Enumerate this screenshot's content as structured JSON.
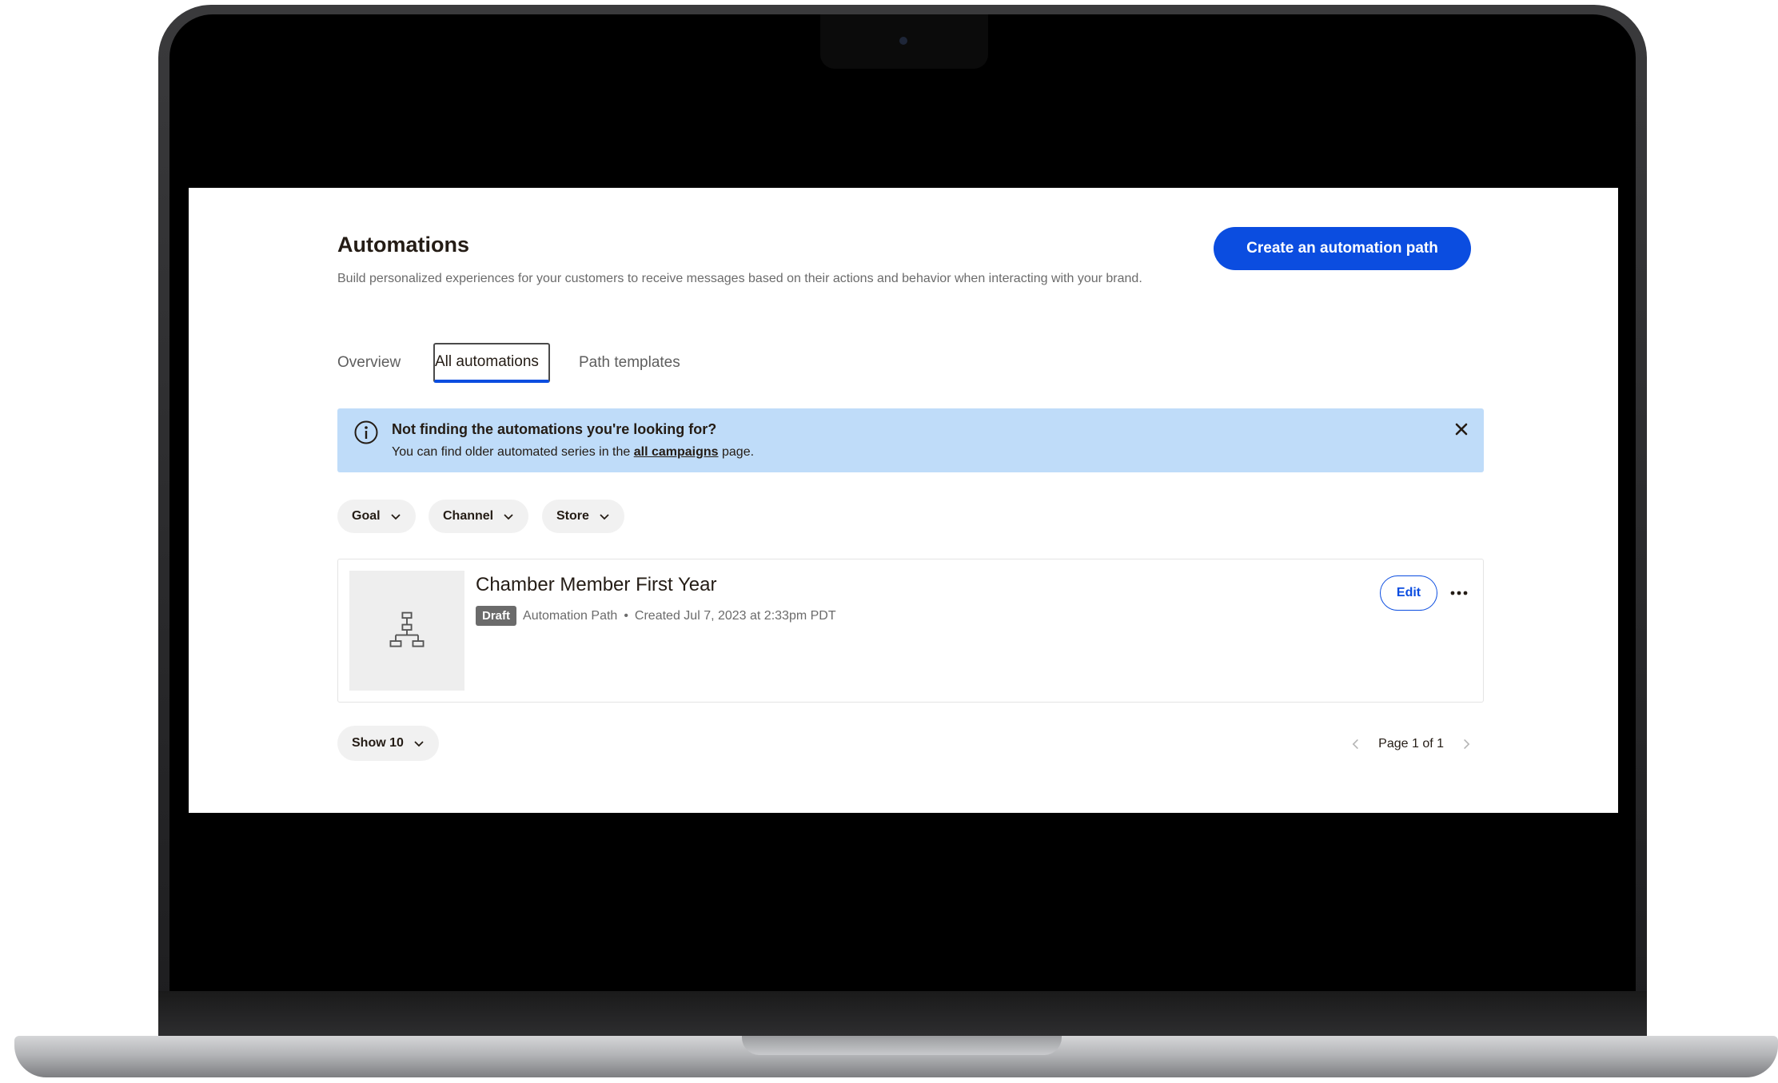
{
  "header": {
    "title": "Automations",
    "description": "Build personalized experiences for your customers to receive messages based on their actions and behavior when interacting with your brand.",
    "primary_action": "Create an automation path"
  },
  "tabs": [
    {
      "label": "Overview",
      "active": false
    },
    {
      "label": "All automations",
      "active": true
    },
    {
      "label": "Path templates",
      "active": false
    }
  ],
  "banner": {
    "title": "Not finding the automations you're looking for?",
    "body_before": "You can find older automated series in the ",
    "link_text": "all campaigns",
    "body_after": " page."
  },
  "filters": [
    {
      "label": "Goal"
    },
    {
      "label": "Channel"
    },
    {
      "label": "Store"
    }
  ],
  "items": [
    {
      "title": "Chamber Member First Year",
      "status": "Draft",
      "type": "Automation Path",
      "separator": "•",
      "created": "Created Jul 7, 2023 at 2:33pm PDT",
      "edit_label": "Edit"
    }
  ],
  "footer": {
    "page_size_label": "Show 10",
    "page_text": "Page 1 of 1"
  },
  "colors": {
    "accent": "#0b4de0",
    "banner_bg": "#bfdcf9",
    "badge_bg": "#6b6b6b"
  }
}
